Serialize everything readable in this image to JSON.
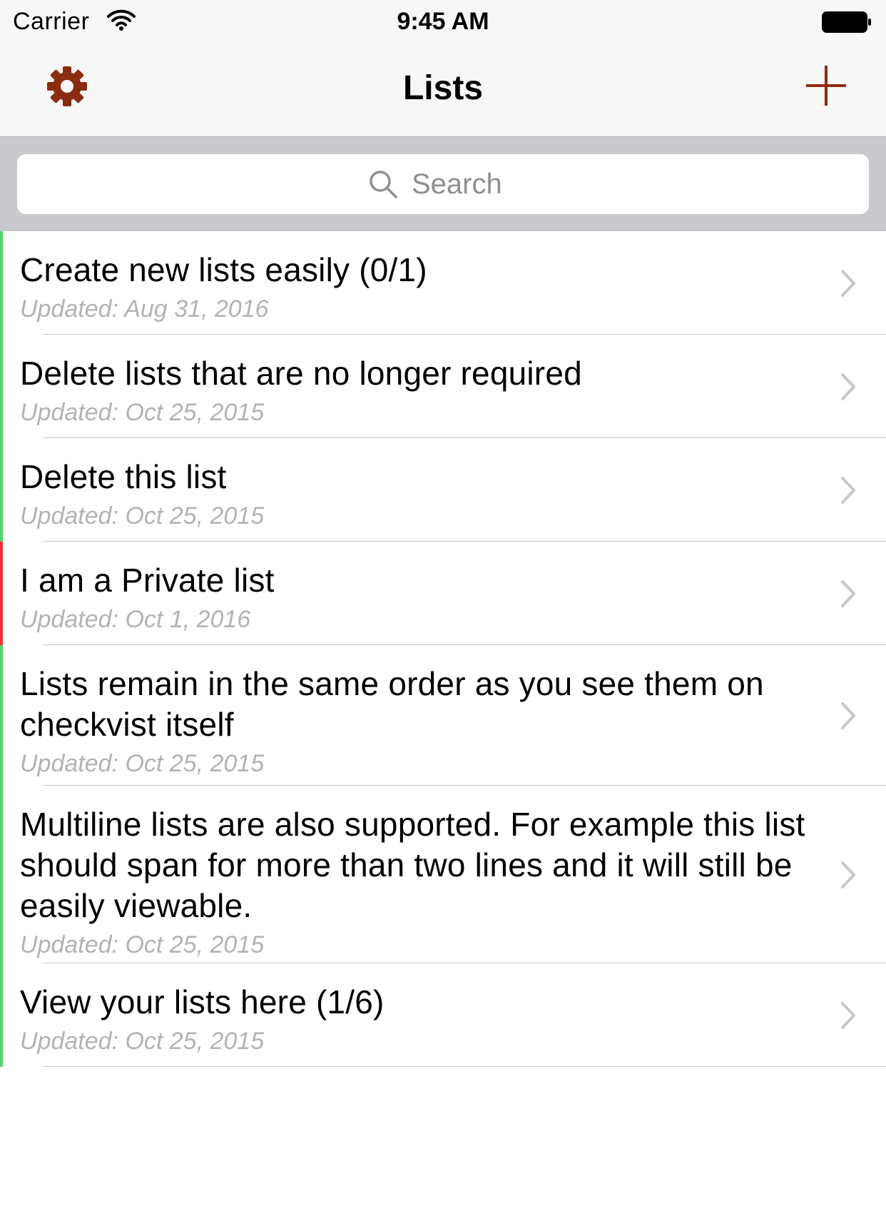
{
  "status_bar": {
    "carrier": "Carrier",
    "time": "9:45 AM"
  },
  "nav": {
    "title": "Lists",
    "settings_icon": "gear-icon",
    "add_icon": "plus-icon",
    "accent_color": "#8b2c0f"
  },
  "search": {
    "placeholder": "Search"
  },
  "list": {
    "items": [
      {
        "title": "Create new lists easily (0/1)",
        "subtitle": "Updated: Aug 31, 2016",
        "indicator": "#4cd964"
      },
      {
        "title": "Delete lists that are no longer required",
        "subtitle": "Updated: Oct 25, 2015",
        "indicator": "#4cd964"
      },
      {
        "title": "Delete this list",
        "subtitle": "Updated: Oct 25, 2015",
        "indicator": "#4cd964"
      },
      {
        "title": "I am a Private list",
        "subtitle": "Updated: Oct 1, 2016",
        "indicator": "#ff2d2d"
      },
      {
        "title": "Lists remain in the same order as you see them on checkvist itself",
        "subtitle": "Updated: Oct 25, 2015",
        "indicator": "#4cd964"
      },
      {
        "title": "Multiline lists are also supported. For example this list should span for more than two lines and it will still be easily viewable.",
        "subtitle": "Updated: Oct 25, 2015",
        "indicator": "#4cd964"
      },
      {
        "title": "View your lists here (1/6)",
        "subtitle": "Updated: Oct 25, 2015",
        "indicator": "#4cd964"
      }
    ]
  }
}
